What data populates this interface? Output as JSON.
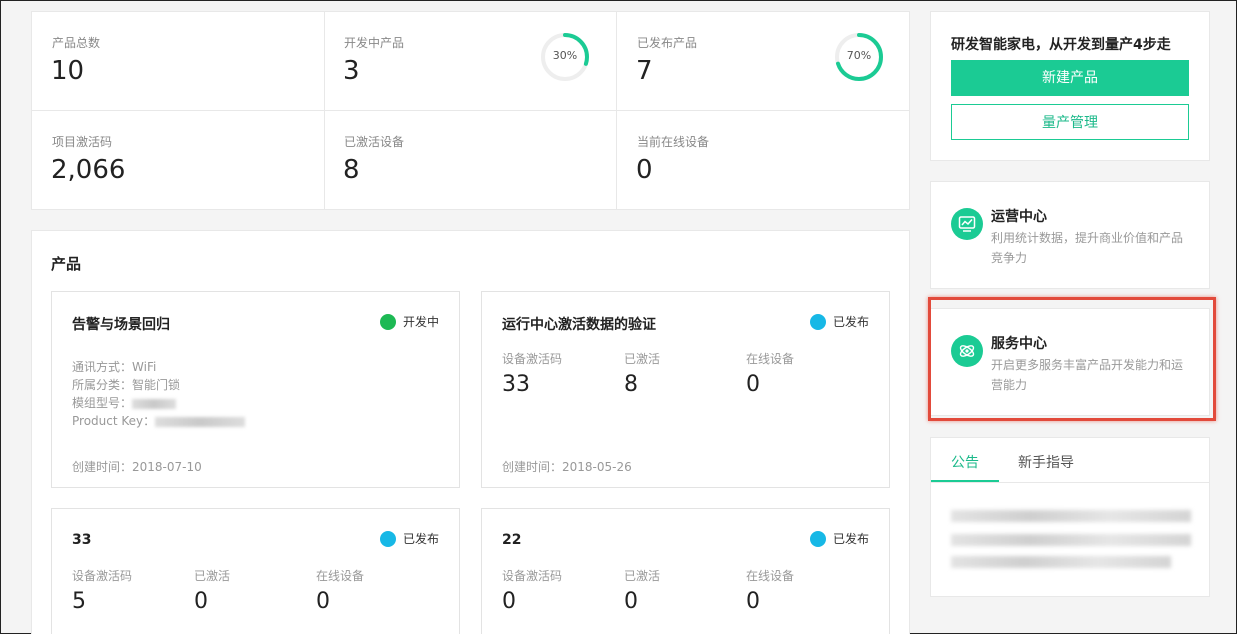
{
  "stats": [
    {
      "label": "产品总数",
      "value": "10"
    },
    {
      "label": "开发中产品",
      "value": "3",
      "ring_percent": "30%",
      "ring_fraction": 0.3
    },
    {
      "label": "已发布产品",
      "value": "7",
      "ring_percent": "70%",
      "ring_fraction": 0.7
    },
    {
      "label": "项目激活码",
      "value": "2,066"
    },
    {
      "label": "已激活设备",
      "value": "8"
    },
    {
      "label": "当前在线设备",
      "value": "0"
    }
  ],
  "products": {
    "title": "产品",
    "cards": [
      {
        "name": "告警与场景回归",
        "status": "开发中",
        "status_color": "#1db954",
        "info": [
          {
            "label": "通讯方式：",
            "value": "WiFi"
          },
          {
            "label": "所属分类：",
            "value": "智能门锁"
          },
          {
            "label": "模组型号：",
            "value": ""
          },
          {
            "label": "Product Key：",
            "value": ""
          }
        ],
        "created": "创建时间：2018-07-10"
      },
      {
        "name": "运行中心激活数据的验证",
        "status": "已发布",
        "status_color": "#17b8e6",
        "metrics": [
          {
            "label": "设备激活码",
            "value": "33"
          },
          {
            "label": "已激活",
            "value": "8"
          },
          {
            "label": "在线设备",
            "value": "0"
          }
        ],
        "created": "创建时间：2018-05-26"
      },
      {
        "name": "33",
        "status": "已发布",
        "status_color": "#17b8e6",
        "metrics": [
          {
            "label": "设备激活码",
            "value": "5"
          },
          {
            "label": "已激活",
            "value": "0"
          },
          {
            "label": "在线设备",
            "value": "0"
          }
        ]
      },
      {
        "name": "22",
        "status": "已发布",
        "status_color": "#17b8e6",
        "metrics": [
          {
            "label": "设备激活码",
            "value": "0"
          },
          {
            "label": "已激活",
            "value": "0"
          },
          {
            "label": "在线设备",
            "value": "0"
          }
        ]
      }
    ]
  },
  "promo": {
    "title": "研发智能家电，从开发到量产4步走",
    "new_product_label": "新建产品",
    "mass_production_label": "量产管理",
    "accent": "#1bcb94"
  },
  "ops_center": {
    "title": "运营中心",
    "desc": "利用统计数据，提升商业价值和产品竞争力",
    "icon": "monitor-chart-icon"
  },
  "service_center": {
    "title": "服务中心",
    "desc": "开启更多服务丰富产品开发能力和运营能力",
    "icon": "service-orbit-icon",
    "highlight_color": "#e24a3b"
  },
  "notice": {
    "tabs": [
      "公告",
      "新手指导"
    ],
    "active_tab": "公告"
  }
}
